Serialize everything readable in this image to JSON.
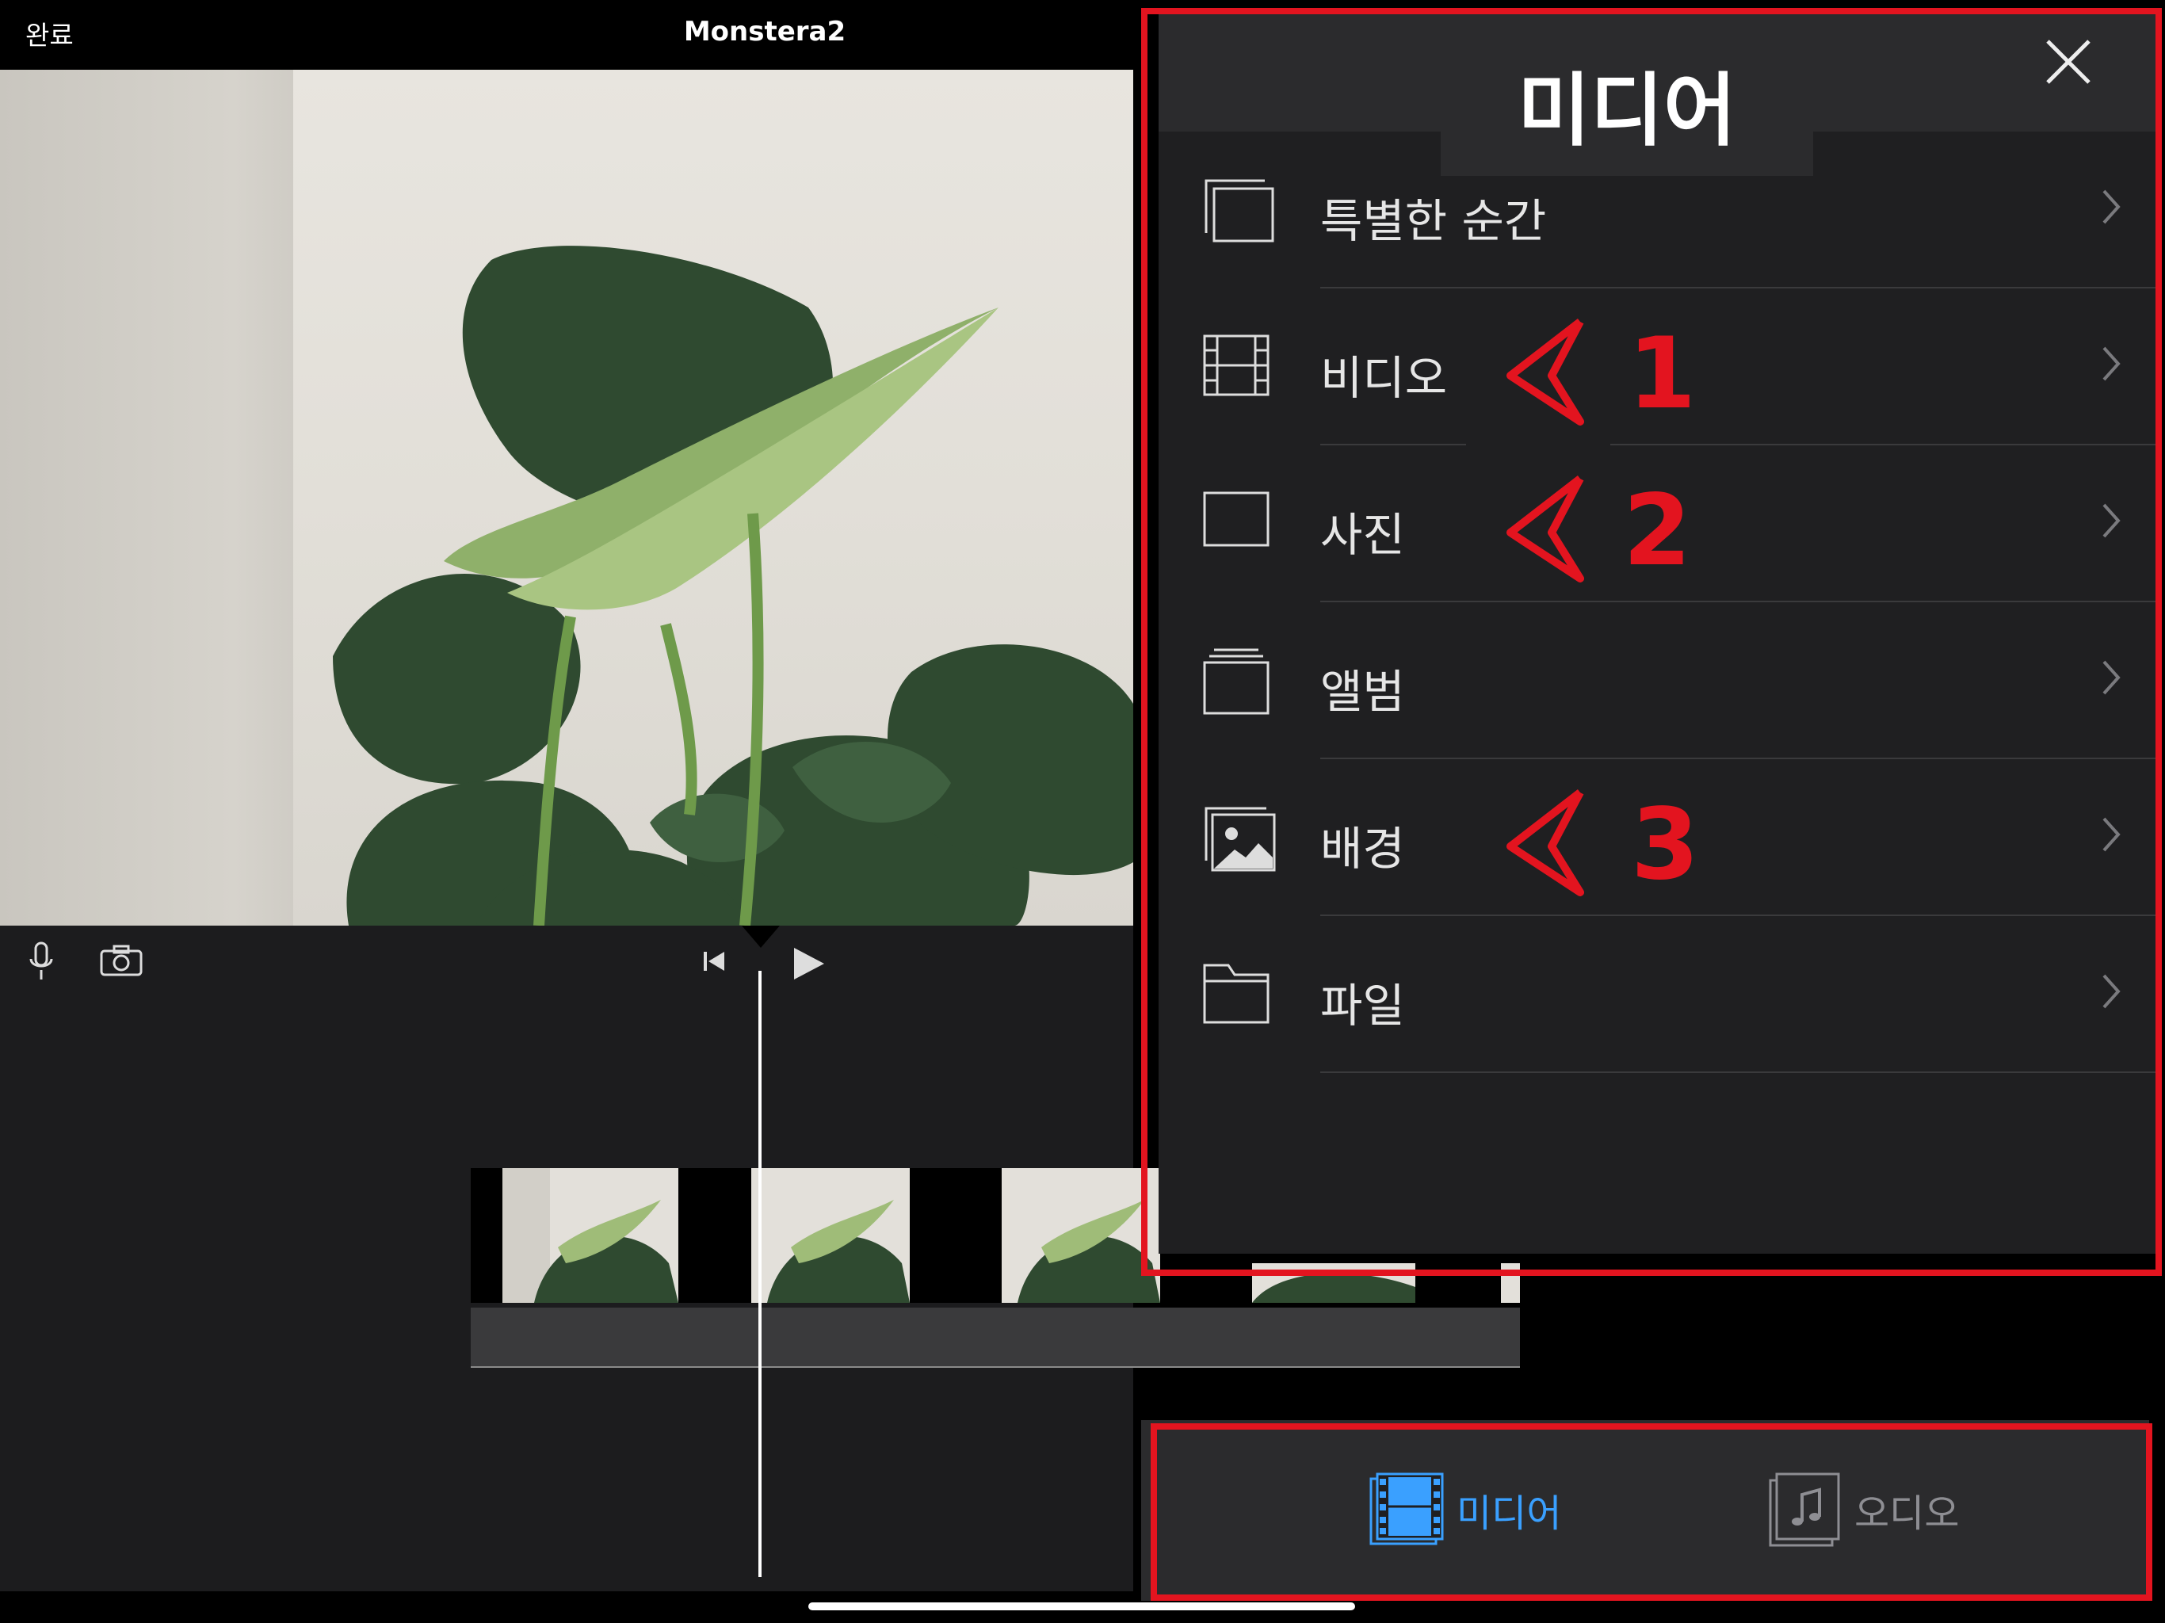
{
  "topbar": {
    "done_label": "완료",
    "project_title": "Monstera2"
  },
  "media_panel": {
    "title": "미디어",
    "items": [
      {
        "label": "특별한 순간",
        "icon": "moments-icon"
      },
      {
        "label": "비디오",
        "icon": "film-icon"
      },
      {
        "label": "사진",
        "icon": "photo-frame-icon"
      },
      {
        "label": "앨범",
        "icon": "album-stack-icon"
      },
      {
        "label": "배경",
        "icon": "landscape-image-icon"
      },
      {
        "label": "파일",
        "icon": "folder-icon"
      }
    ]
  },
  "annotations": [
    {
      "number": "1",
      "target": "비디오"
    },
    {
      "number": "2",
      "target": "사진"
    },
    {
      "number": "3",
      "target": "배경"
    }
  ],
  "tabbar": {
    "tabs": [
      {
        "label": "미디어",
        "selected": true,
        "icon": "film-icon"
      },
      {
        "label": "오디오",
        "selected": false,
        "icon": "music-note-icon"
      }
    ]
  },
  "colors": {
    "annotation_red": "#e3141f",
    "selected_tab": "#3aa0ff",
    "panel_bg": "#1f1f21"
  }
}
